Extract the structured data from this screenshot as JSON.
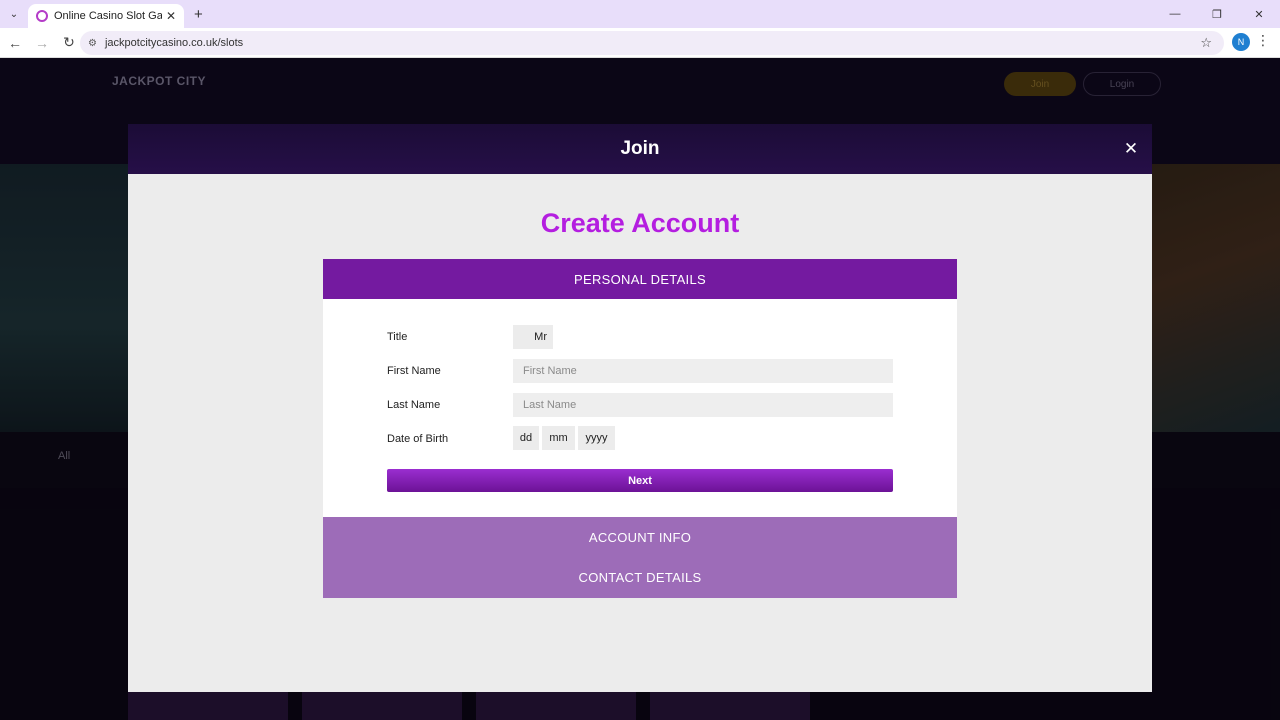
{
  "browser": {
    "tab_title": "Online Casino Slot Games | Jac",
    "url": "jackpotcitycasino.co.uk/slots",
    "profile_initial": "N"
  },
  "site": {
    "logo": "JACKPOT CITY",
    "join_label": "Join",
    "login_label": "Login",
    "filter_all": "All"
  },
  "modal": {
    "title": "Join",
    "heading": "Create Account",
    "sections": {
      "personal": "PERSONAL DETAILS",
      "account": "ACCOUNT INFO",
      "contact": "CONTACT DETAILS"
    },
    "form": {
      "title_label": "Title",
      "title_value": "Mr",
      "first_name_label": "First Name",
      "first_name_placeholder": "First Name",
      "last_name_label": "Last Name",
      "last_name_placeholder": "Last Name",
      "dob_label": "Date of Birth",
      "dob_day": "dd",
      "dob_month": "mm",
      "dob_year": "yyyy",
      "next_label": "Next"
    }
  },
  "colors": {
    "heading": "#b41ee0",
    "active_section": "#741aa0",
    "inactive_section": "#9d6cb8"
  }
}
